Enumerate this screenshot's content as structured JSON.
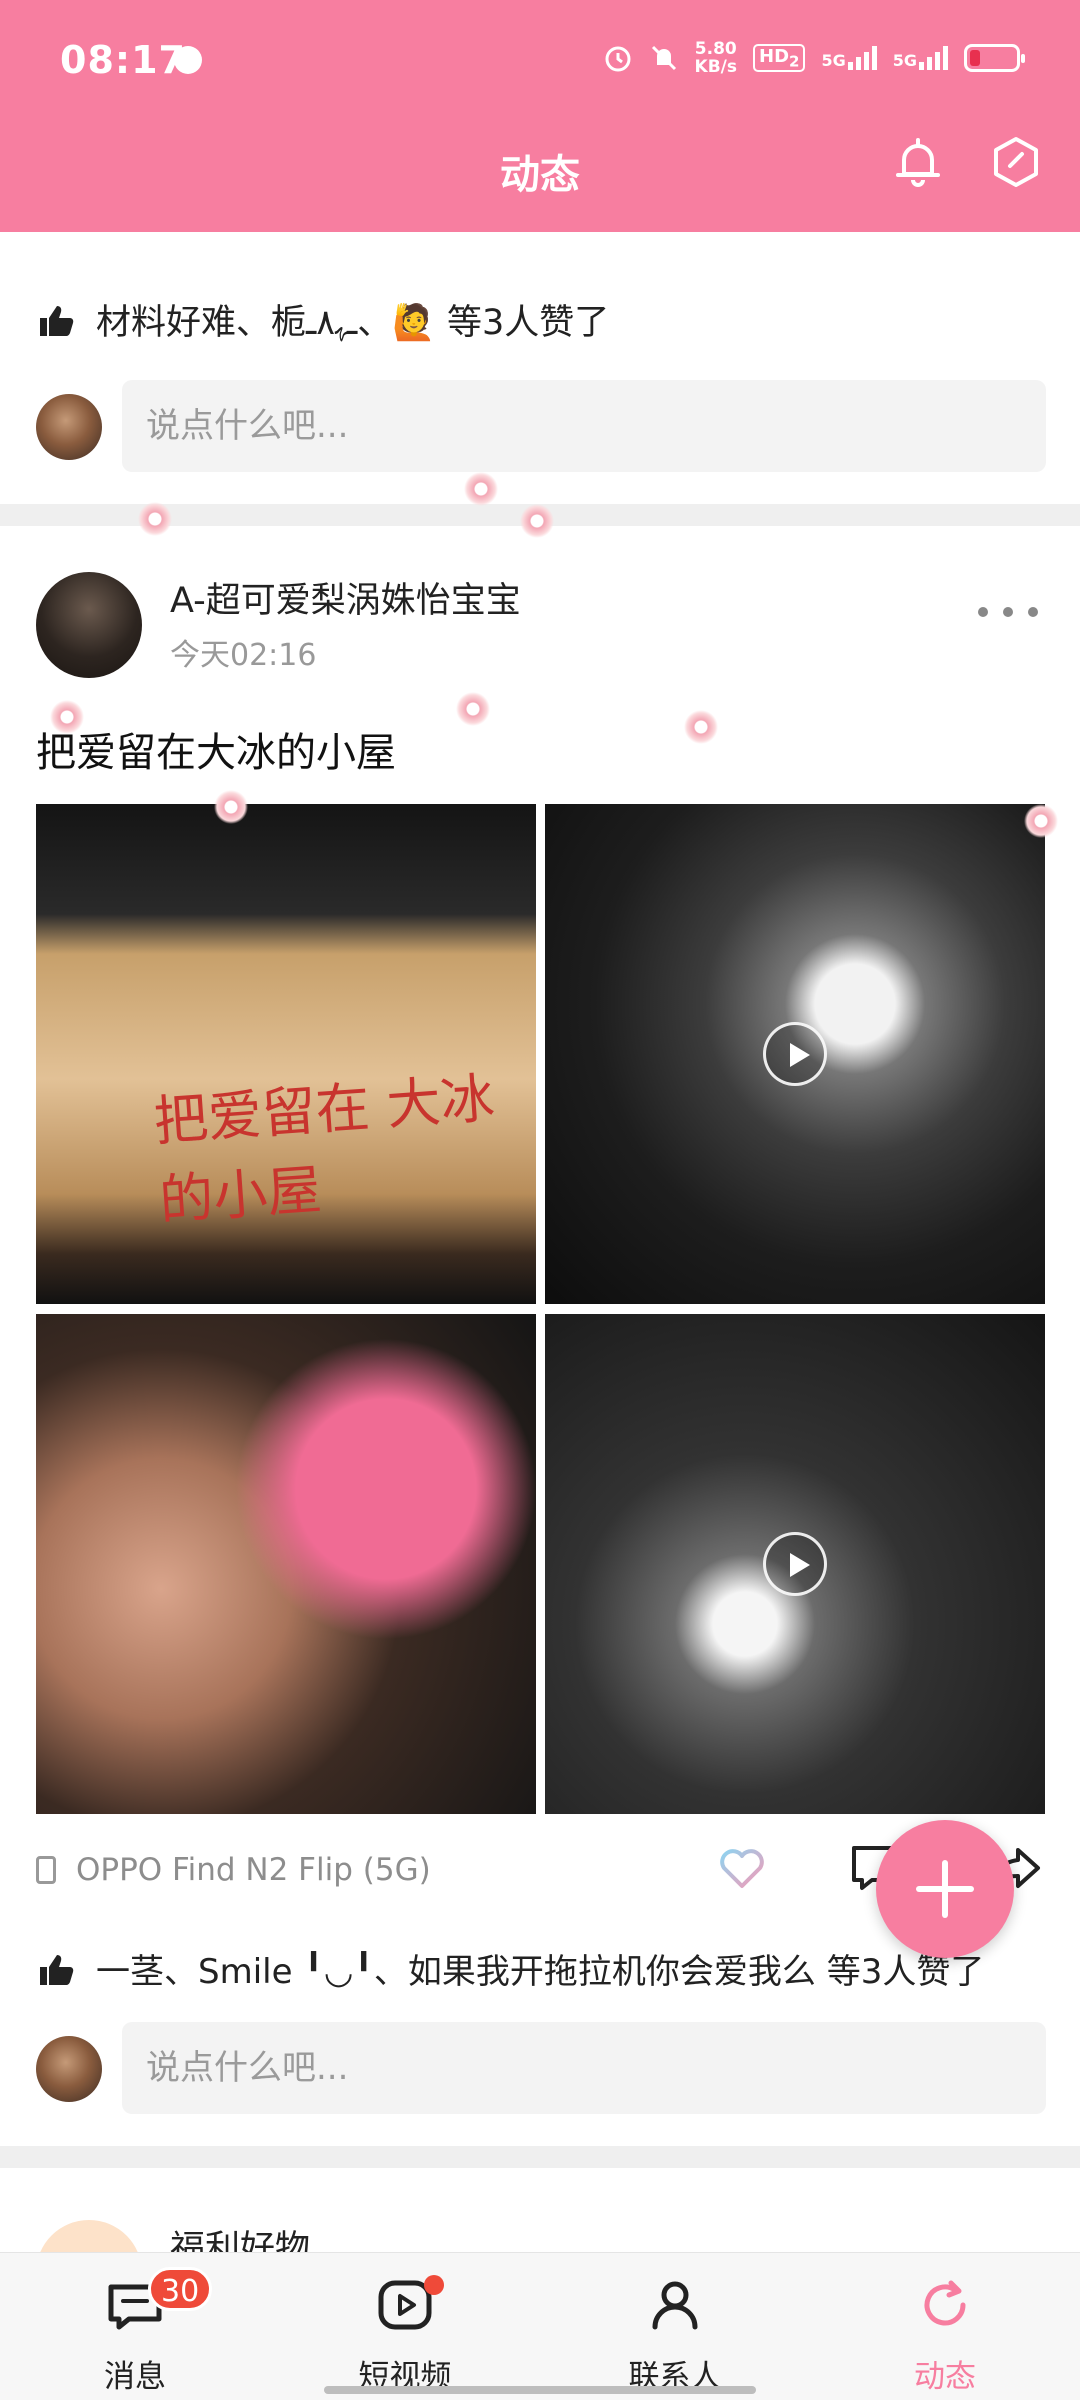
{
  "status_bar": {
    "time": "08:17",
    "speed_value": "5.80",
    "speed_unit": "KB/s",
    "hd": "HD",
    "hd_sub": "2",
    "net1": "5G",
    "net2": "5G"
  },
  "header": {
    "title": "动态"
  },
  "prev_post": {
    "likes_text": "材料好难、栀ـﮩ٨ـ、🙋 等3人赞了",
    "comment_placeholder": "说点什么吧..."
  },
  "post": {
    "author": "A-超可爱梨涡姝怡宝宝",
    "time": "今天02:16",
    "text": "把爱留在大冰的小屋",
    "banner_text": "把爱留在 大冰的小屋",
    "device": "OPPO Find N2 Flip (5G)",
    "likes_text": "一茎、Smile ╹◡╹、如果我开拖拉机你会爱我么 等3人赞了",
    "comment_placeholder": "说点什么吧..."
  },
  "next_post": {
    "author": "福利好物"
  },
  "bottom_nav": {
    "items": [
      {
        "label": "消息",
        "badge": "30"
      },
      {
        "label": "短视频"
      },
      {
        "label": "联系人"
      },
      {
        "label": "动态"
      }
    ]
  },
  "colors": {
    "brand": "#f77ea0",
    "badge": "#ef4a39",
    "like_heart": "#8fd3f0"
  },
  "icons": [
    "bell-icon",
    "hexagon-settings-icon",
    "thumb-up-icon",
    "more-icon",
    "play-icon",
    "phone-icon",
    "heart-icon",
    "comment-icon",
    "share-icon",
    "plus-icon",
    "message-icon",
    "video-icon",
    "contacts-icon",
    "refresh-icon"
  ]
}
